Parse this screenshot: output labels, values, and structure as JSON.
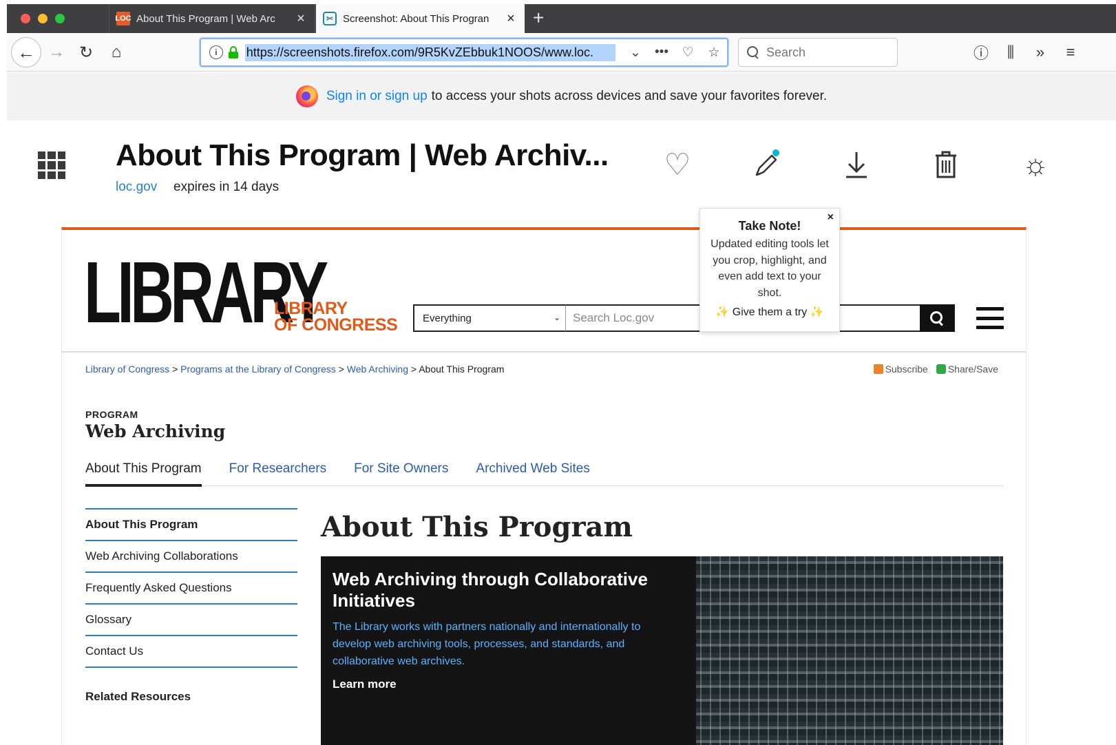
{
  "browser": {
    "tabs": [
      {
        "favicon": "LOC",
        "title": "About This Program  |  Web Arc",
        "active": false
      },
      {
        "favicon": "screenshots-icon",
        "title": "Screenshot: About This Progran",
        "active": true
      }
    ],
    "new_tab": "+",
    "url": "https://screenshots.firefox.com/9R5KvZEbbuk1NOOS/www.loc.",
    "search_placeholder": "Search"
  },
  "banner": {
    "link": "Sign in or sign up",
    "text": "to access your shots across devices and save your favorites forever."
  },
  "shot": {
    "title": "About This Program  | Web Archiv...",
    "domain": "loc.gov",
    "expires": "expires in 14 days"
  },
  "popup": {
    "title": "Take Note!",
    "body": "Updated editing tools let you crop, highlight, and even add text to your shot.",
    "cta": "Give them a try"
  },
  "loc": {
    "logo_big": "LIBRARY",
    "logo_sub_1": "LIBRARY",
    "logo_sub_2": "OF CONGRESS",
    "select_value": "Everything",
    "search_placeholder": "Search Loc.gov",
    "breadcrumb": [
      "Library of Congress",
      "Programs at the Library of Congress",
      "Web Archiving",
      "About This Program"
    ],
    "breadcrumb_sep": ">",
    "subscribe": "Subscribe",
    "share": "Share/Save",
    "program_label": "PROGRAM",
    "program_title": "Web Archiving",
    "tabs": [
      "About This Program",
      "For Researchers",
      "For Site Owners",
      "Archived Web Sites"
    ],
    "sidebar": [
      "About This Program",
      "Web Archiving Collaborations",
      "Frequently Asked Questions",
      "Glossary",
      "Contact Us"
    ],
    "related": "Related Resources",
    "main_title": "About This Program",
    "hero": {
      "title": "Web Archiving through Collaborative Initiatives",
      "text": "The Library works with partners nationally and internationally to develop web archiving tools, processes, and standards, and collaborative web archives.",
      "link": "Learn more"
    }
  },
  "colors": {
    "loc_orange": "#e05a19",
    "link_blue": "#2b5cad",
    "firefox_blue": "#0a84ff"
  }
}
